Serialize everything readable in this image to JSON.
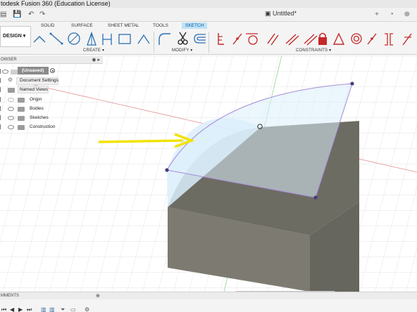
{
  "window": {
    "title": "todesk Fusion 360 (Education License)",
    "document_tab": "Untitled*"
  },
  "ribbon": {
    "workspace": "DESIGN",
    "tabs": [
      "SOLID",
      "SURFACE",
      "SHEET METAL",
      "TOOLS",
      "SKETCH"
    ],
    "active_tab": "SKETCH",
    "groups": [
      "CREATE",
      "MODIFY",
      "CONSTRAINTS"
    ]
  },
  "browser": {
    "title": "OWSER",
    "items": [
      {
        "label": "(Unsaved)"
      },
      {
        "label": "Document Settings"
      },
      {
        "label": "Named Views"
      },
      {
        "label": "Origin"
      },
      {
        "label": "Bodies"
      },
      {
        "label": "Sketches"
      },
      {
        "label": "Construction"
      }
    ]
  },
  "comments": {
    "label": "MMENTS"
  },
  "colors": {
    "accent": "#0c5aa0",
    "active_tab_bg": "#bfe2f6",
    "sketch_profile_fill": "#dbeefb",
    "sketch_profile_stroke": "#a78bd6",
    "body_top": "#6d6c63",
    "body_front": "#7d7b71",
    "body_side": "#66655e",
    "annotation_arrow": "#f2e200"
  },
  "icons": {
    "ribbon_create": [
      "line-icon",
      "two-point-rectangle-icon",
      "circle-icon",
      "arc-icon",
      "polygon-icon",
      "fit-point-spline-icon",
      "rectangle-icon",
      "slot-icon",
      "point-icon"
    ],
    "ribbon_modify": [
      "fillet-icon",
      "trim-icon",
      "offset-icon"
    ],
    "ribbon_constraints": [
      "coincident-icon",
      "collinear-icon",
      "tangent-icon",
      "equal-icon",
      "parallel-icon",
      "perpendicular-icon",
      "fix-lock-icon",
      "midpoint-icon",
      "concentric-icon",
      "symmetry-icon"
    ]
  }
}
